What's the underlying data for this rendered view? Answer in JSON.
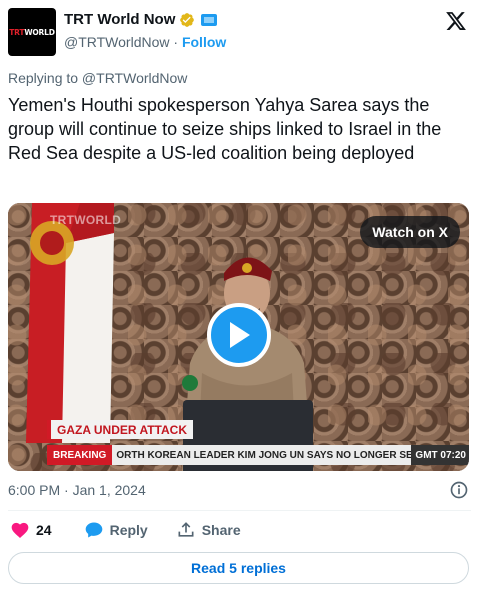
{
  "header": {
    "avatar_text_red": "TRT",
    "avatar_text_white": "WORLD",
    "name": "TRT World Now",
    "handle": "@TRTWorldNow",
    "separator": " · ",
    "follow": "Follow"
  },
  "reply_to": "Replying to @TRTWorldNow",
  "tweet_text": "Yemen's Houthi spokesperson Yahya Sarea says the group will continue to seize ships linked to Israel in the Red Sea despite a US-led coalition being deployed",
  "media": {
    "logo": "TRTWORLD",
    "watch_label": "Watch on X",
    "gaza_label": "GAZA UNDER ATTACK",
    "ticker_label": "BREAKING",
    "ticker_text": "ORTH KOREAN LEADER KIM JONG UN SAYS NO LONGER SEEI",
    "ticker_time": "GMT 07:20"
  },
  "timestamp": "6:00 PM · Jan 1, 2024",
  "actions": {
    "like_count": "24",
    "reply_label": "Reply",
    "share_label": "Share"
  },
  "read_replies": "Read 5 replies",
  "colors": {
    "accent": "#1d9bf0",
    "heart": "#f91880",
    "breaking_red": "#d11a26"
  },
  "icons": [
    "verified-badge-icon",
    "affiliate-badge-icon",
    "x-logo-icon",
    "play-icon",
    "info-icon",
    "heart-icon",
    "reply-bubble-icon",
    "share-icon"
  ]
}
